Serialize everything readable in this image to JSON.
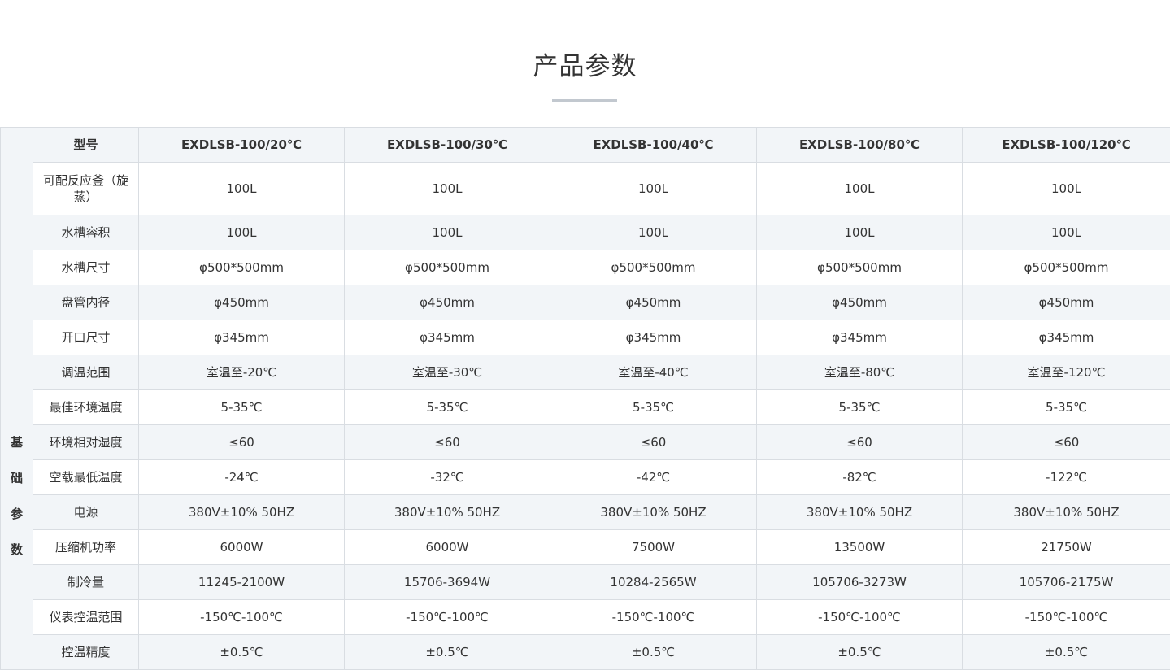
{
  "heading": {
    "title": "产品参数"
  },
  "table": {
    "group_label": [
      "基",
      "础",
      "参",
      "数"
    ],
    "header": {
      "label": "型号",
      "models": [
        "EXDLSB-100/20℃",
        "EXDLSB-100/30℃",
        "EXDLSB-100/40℃",
        "EXDLSB-100/80℃",
        "EXDLSB-100/120℃"
      ]
    },
    "rows": [
      {
        "label": "可配反应釜（旋蒸）",
        "values": [
          "100L",
          "100L",
          "100L",
          "100L",
          "100L"
        ]
      },
      {
        "label": "水槽容积",
        "values": [
          "100L",
          "100L",
          "100L",
          "100L",
          "100L"
        ]
      },
      {
        "label": "水槽尺寸",
        "values": [
          "φ500*500mm",
          "φ500*500mm",
          "φ500*500mm",
          "φ500*500mm",
          "φ500*500mm"
        ]
      },
      {
        "label": "盘管内径",
        "values": [
          "φ450mm",
          "φ450mm",
          "φ450mm",
          "φ450mm",
          "φ450mm"
        ]
      },
      {
        "label": "开口尺寸",
        "values": [
          "φ345mm",
          "φ345mm",
          "φ345mm",
          "φ345mm",
          "φ345mm"
        ]
      },
      {
        "label": "调温范围",
        "values": [
          "室温至-20℃",
          "室温至-30℃",
          "室温至-40℃",
          "室温至-80℃",
          "室温至-120℃"
        ]
      },
      {
        "label": "最佳环境温度",
        "values": [
          "5-35℃",
          "5-35℃",
          "5-35℃",
          "5-35℃",
          "5-35℃"
        ]
      },
      {
        "label": "环境相对湿度",
        "values": [
          "≤60",
          "≤60",
          "≤60",
          "≤60",
          "≤60"
        ]
      },
      {
        "label": "空载最低温度",
        "values": [
          "-24℃",
          "-32℃",
          "-42℃",
          "-82℃",
          "-122℃"
        ]
      },
      {
        "label": "电源",
        "values": [
          "380V±10%  50HZ",
          "380V±10%  50HZ",
          "380V±10%  50HZ",
          "380V±10%  50HZ",
          "380V±10%  50HZ"
        ]
      },
      {
        "label": "压缩机功率",
        "values": [
          "6000W",
          "6000W",
          "7500W",
          "13500W",
          "21750W"
        ]
      },
      {
        "label": "制冷量",
        "values": [
          "11245-2100W",
          "15706-3694W",
          "10284-2565W",
          "105706-3273W",
          "105706-2175W"
        ]
      },
      {
        "label": "仪表控温范围",
        "values": [
          "-150℃-100℃",
          "-150℃-100℃",
          "-150℃-100℃",
          "-150℃-100℃",
          "-150℃-100℃"
        ]
      },
      {
        "label": "控温精度",
        "values": [
          "±0.5℃",
          "±0.5℃",
          "±0.5℃",
          "±0.5℃",
          "±0.5℃"
        ]
      }
    ]
  }
}
